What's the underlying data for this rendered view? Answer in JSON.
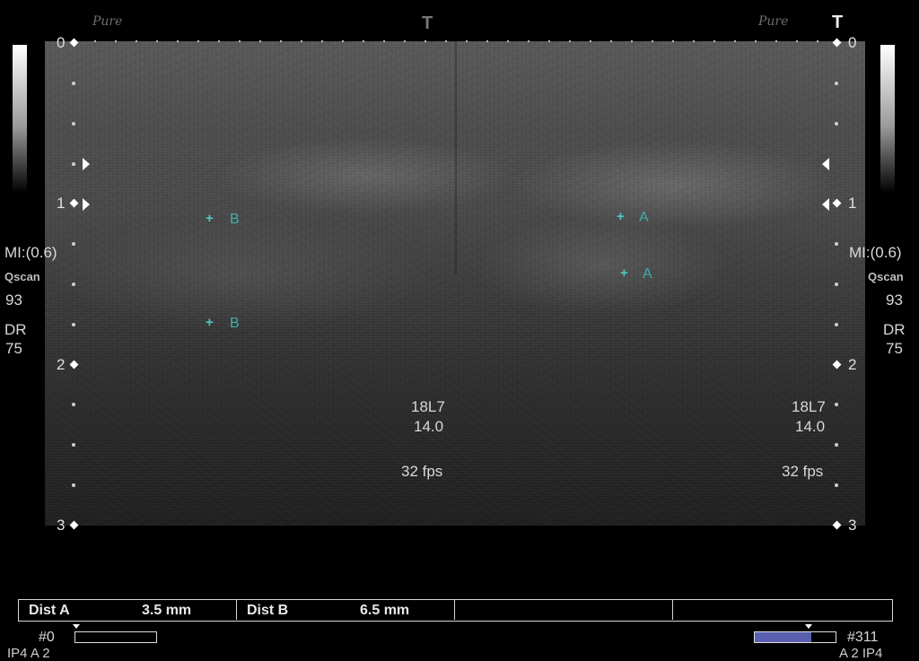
{
  "logos": {
    "left": "Pure",
    "right": "Pure"
  },
  "orient_marks": {
    "left": "T",
    "right": "T"
  },
  "depth_scale": [
    "0",
    "1",
    "2",
    "3"
  ],
  "side_info": {
    "mi": "MI:(0.6)",
    "qscan_label": "Qscan",
    "qscan_value": "93",
    "dr_label": "DR",
    "dr_value": "75"
  },
  "probe_info": {
    "probe": "18L7",
    "freq": "14.0",
    "fps": "32 fps"
  },
  "calipers": {
    "b_top": "B",
    "b_bottom": "B",
    "a_top": "A",
    "a_bottom": "A",
    "marker": "+"
  },
  "measurements": [
    {
      "label": "Dist  A",
      "value": "3.5  mm"
    },
    {
      "label": "Dist  B",
      "value": "6.5  mm"
    }
  ],
  "cine": {
    "left_frame": "#0",
    "right_frame": "#311",
    "fill_fraction": 0.7
  },
  "bottom_labels": {
    "left": "IP4   A 2",
    "right": "A 2   IP4"
  },
  "colors": {
    "caliper": "#4fc8c0",
    "cine_fill": "#5a5fb0"
  }
}
